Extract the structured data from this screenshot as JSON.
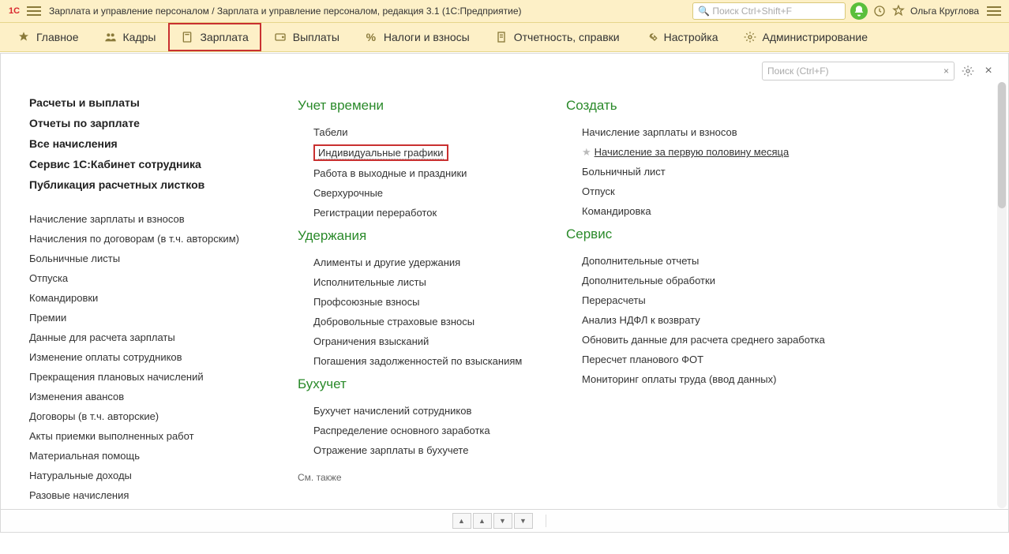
{
  "titlebar": {
    "title": "Зарплата и управление персоналом / Зарплата и управление персоналом, редакция 3.1  (1С:Предприятие)",
    "search_placeholder": "Поиск Ctrl+Shift+F",
    "user": "Ольга Круглова"
  },
  "nav": [
    {
      "label": "Главное",
      "icon": "star"
    },
    {
      "label": "Кадры",
      "icon": "people"
    },
    {
      "label": "Зарплата",
      "icon": "calc",
      "active": true
    },
    {
      "label": "Выплаты",
      "icon": "wallet"
    },
    {
      "label": "Налоги и взносы",
      "icon": "percent"
    },
    {
      "label": "Отчетность, справки",
      "icon": "doc"
    },
    {
      "label": "Настройка",
      "icon": "wrench"
    },
    {
      "label": "Администрирование",
      "icon": "gear"
    }
  ],
  "panel": {
    "search_placeholder": "Поиск (Ctrl+F)"
  },
  "col1": {
    "top": [
      "Расчеты и выплаты",
      "Отчеты по зарплате",
      "Все начисления",
      "Сервис 1С:Кабинет сотрудника",
      "Публикация расчетных листков"
    ],
    "rest": [
      "Начисление зарплаты и взносов",
      "Начисления по договорам (в т.ч. авторским)",
      "Больничные листы",
      "Отпуска",
      "Командировки",
      "Премии",
      "Данные для расчета зарплаты",
      "Изменение оплаты сотрудников",
      "Прекращения плановых начислений",
      "Изменения авансов",
      "Договоры (в т.ч. авторские)",
      "Акты приемки выполненных работ",
      "Материальная помощь",
      "Натуральные доходы",
      "Разовые начисления"
    ]
  },
  "col2": {
    "s1": {
      "head": "Учет времени",
      "items": [
        "Табели",
        "Индивидуальные графики",
        "Работа в выходные и праздники",
        "Сверхурочные",
        "Регистрации переработок"
      ]
    },
    "s2": {
      "head": "Удержания",
      "items": [
        "Алименты и другие удержания",
        "Исполнительные листы",
        "Профсоюзные взносы",
        "Добровольные страховые взносы",
        "Ограничения взысканий",
        "Погашения задолженностей по взысканиям"
      ]
    },
    "s3": {
      "head": "Бухучет",
      "items": [
        "Бухучет начислений сотрудников",
        "Распределение основного заработка",
        "Отражение зарплаты в бухучете"
      ]
    },
    "see_also": "См. также"
  },
  "col3": {
    "s1": {
      "head": "Создать",
      "items": [
        "Начисление зарплаты и взносов",
        "Начисление за первую половину месяца",
        "Больничный лист",
        "Отпуск",
        "Командировка"
      ]
    },
    "s2": {
      "head": "Сервис",
      "items": [
        "Дополнительные отчеты",
        "Дополнительные обработки",
        "Перерасчеты",
        "Анализ НДФЛ к возврату",
        "Обновить данные для расчета среднего заработка",
        "Пересчет планового ФОТ",
        "Мониторинг оплаты труда (ввод данных)"
      ]
    }
  }
}
